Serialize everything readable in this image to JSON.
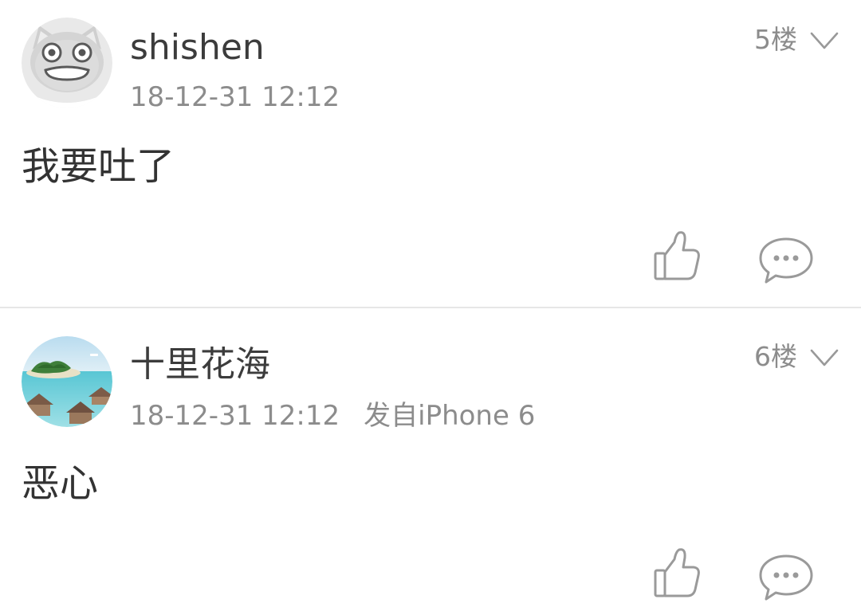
{
  "posts": [
    {
      "username": "shishen",
      "timestamp": "18-12-31 12:12",
      "device": "",
      "floor": "5楼",
      "content": "我要吐了",
      "avatar": "cartoon-face-avatar",
      "actions": [
        "thumbs-up-icon",
        "comment-bubble-icon"
      ]
    },
    {
      "username": "十里花海",
      "timestamp": "18-12-31 12:12",
      "device": "发自iPhone 6",
      "floor": "6楼",
      "content": "恶心",
      "avatar": "island-beach-photo-avatar",
      "actions": [
        "thumbs-up-icon",
        "comment-bubble-icon"
      ]
    }
  ],
  "colors": {
    "text_primary": "#333333",
    "text_secondary": "#8c8c8c",
    "icon_gray": "#999999",
    "divider": "#e6e6e6",
    "background": "#ffffff"
  }
}
